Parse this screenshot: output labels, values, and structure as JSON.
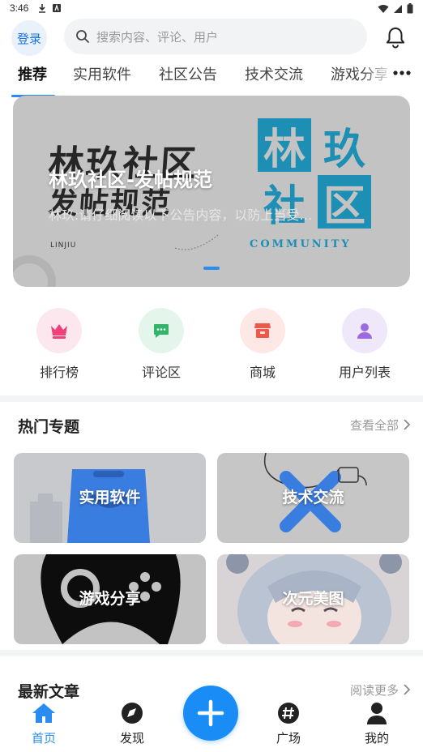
{
  "status_bar": {
    "time": "3:46"
  },
  "header": {
    "login_label": "登录",
    "search_placeholder": "搜索内容、评论、用户"
  },
  "tabs": [
    {
      "label": "推荐",
      "active": true
    },
    {
      "label": "实用软件"
    },
    {
      "label": "社区公告"
    },
    {
      "label": "技术交流"
    },
    {
      "label": "游戏分享"
    }
  ],
  "banner": {
    "image_text_line1": "林玖社区",
    "image_text_line2": "发帖规范",
    "title": "林玖社区-发帖规范",
    "subtitle": "林玖:请仔细阅读以下公告内容，以防上当受…",
    "logo_text": "LINJIU",
    "logo_community": "COMMUNITY",
    "logo_chars": [
      "林",
      "玖",
      "社",
      "区"
    ]
  },
  "quick_links": [
    {
      "label": "排行榜",
      "icon": "crown-icon",
      "bg": "#fde7ef",
      "color": "#f0407a"
    },
    {
      "label": "评论区",
      "icon": "chat-icon",
      "bg": "#e4f6ec",
      "color": "#34b36b"
    },
    {
      "label": "商城",
      "icon": "store-icon",
      "bg": "#fde8e6",
      "color": "#f0584a"
    },
    {
      "label": "用户列表",
      "icon": "user-icon",
      "bg": "#efe8fb",
      "color": "#9b6ae0"
    }
  ],
  "hot_topics": {
    "title": "热门专题",
    "more_label": "查看全部",
    "cards": [
      {
        "label": "实用软件"
      },
      {
        "label": "技术交流"
      },
      {
        "label": "游戏分享"
      },
      {
        "label": "次元美图"
      }
    ]
  },
  "latest": {
    "title": "最新文章",
    "more_label": "阅读更多"
  },
  "bottom_nav": [
    {
      "label": "首页",
      "icon": "home-icon",
      "active": true
    },
    {
      "label": "发现",
      "icon": "compass-icon"
    },
    {
      "label": "广场",
      "icon": "hashtag-icon"
    },
    {
      "label": "我的",
      "icon": "person-icon"
    }
  ],
  "colors": {
    "accent": "#2a8cf0",
    "fab": "#1a8cf5"
  }
}
